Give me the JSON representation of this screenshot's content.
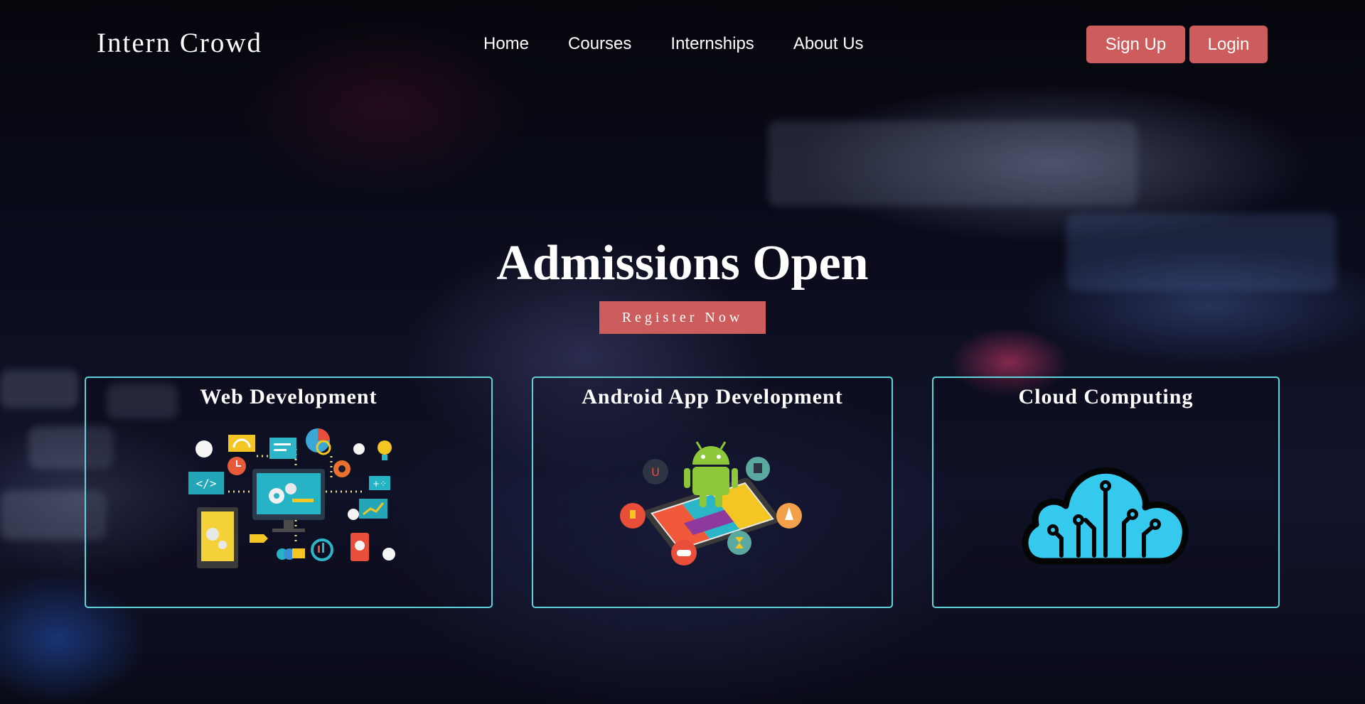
{
  "brand": {
    "name": "Intern Crowd"
  },
  "nav": {
    "items": [
      {
        "label": "Home"
      },
      {
        "label": "Courses"
      },
      {
        "label": "Internships"
      },
      {
        "label": "About Us"
      }
    ]
  },
  "auth": {
    "signup_label": "Sign Up",
    "login_label": "Login"
  },
  "hero": {
    "title": "Admissions Open",
    "cta_label": "Register Now"
  },
  "courses": [
    {
      "title": "Web Development",
      "icon": "web-development-illustration"
    },
    {
      "title": "Android App Development",
      "icon": "android-illustration"
    },
    {
      "title": "Cloud Computing",
      "icon": "cloud-circuit-icon"
    }
  ],
  "colors": {
    "accent": "#cd5c5c",
    "card_border": "#5fd3d8",
    "cloud": "#35c9ee"
  }
}
